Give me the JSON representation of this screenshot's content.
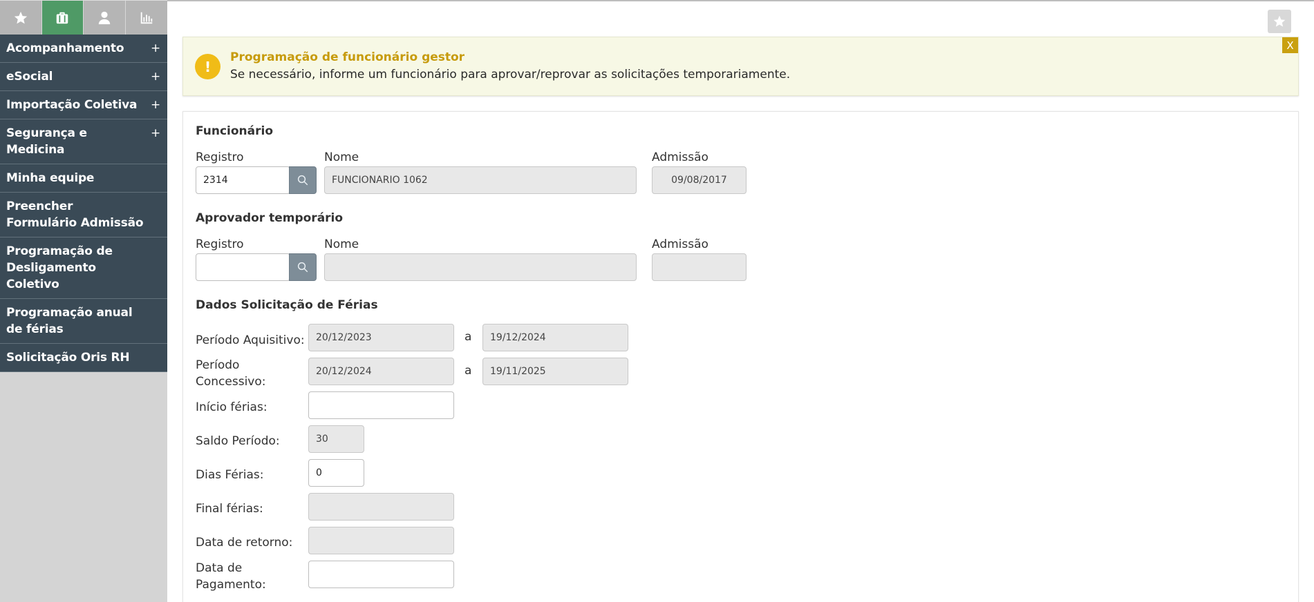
{
  "sidebar": {
    "tabs": [
      {
        "icon": "star-icon"
      },
      {
        "icon": "briefcase-icon"
      },
      {
        "icon": "user-icon"
      },
      {
        "icon": "bar-chart-icon"
      }
    ],
    "items": [
      {
        "label": "Acompanhamento",
        "expand": "+"
      },
      {
        "label": "eSocial",
        "expand": "+"
      },
      {
        "label": "Importação Coletiva",
        "expand": "+"
      },
      {
        "label": "Segurança e Medicina",
        "expand": "+"
      },
      {
        "label": "Minha equipe"
      },
      {
        "label": "Preencher Formulário Admissão"
      },
      {
        "label": "Programação de Desligamento Coletivo"
      },
      {
        "label": "Programação anual de férias"
      },
      {
        "label": "Solicitação Oris RH"
      }
    ]
  },
  "alert": {
    "icon": "!",
    "title": "Programação de funcionário gestor",
    "message": "Se necessário, informe um funcionário para aprovar/reprovar as solicitações temporariamente.",
    "close": "X"
  },
  "funcionario": {
    "title": "Funcionário",
    "registro_label": "Registro",
    "registro_value": "2314",
    "nome_label": "Nome",
    "nome_value": "FUNCIONARIO 1062",
    "admissao_label": "Admissão",
    "admissao_value": "09/08/2017"
  },
  "aprovador": {
    "title": "Aprovador temporário",
    "registro_label": "Registro",
    "registro_value": "",
    "nome_label": "Nome",
    "nome_value": "",
    "admissao_label": "Admissão",
    "admissao_value": ""
  },
  "ferias": {
    "title": "Dados Solicitação de Férias",
    "separator": "a",
    "aquisitivo_label": "Período Aquisitivo:",
    "aquisitivo_inicio": "20/12/2023",
    "aquisitivo_fim": "19/12/2024",
    "concessivo_label_1": "Período",
    "concessivo_label_2": "Concessivo:",
    "concessivo_inicio": "20/12/2024",
    "concessivo_fim": "19/11/2025",
    "inicio_label": "Início férias:",
    "inicio_value": "",
    "saldo_label": "Saldo Período:",
    "saldo_value": "30",
    "dias_label": "Dias Férias:",
    "dias_value": "0",
    "final_label": "Final férias:",
    "final_value": "",
    "retorno_label": "Data de retorno:",
    "retorno_value": "",
    "pagamento_label_1": "Data de",
    "pagamento_label_2": "Pagamento:",
    "pagamento_value": ""
  },
  "colors": {
    "sidebar_bg": "#3a4a56",
    "tab_active": "#4f9a66",
    "alert_title": "#c79b0c",
    "alert_icon": "#f0bc17"
  }
}
